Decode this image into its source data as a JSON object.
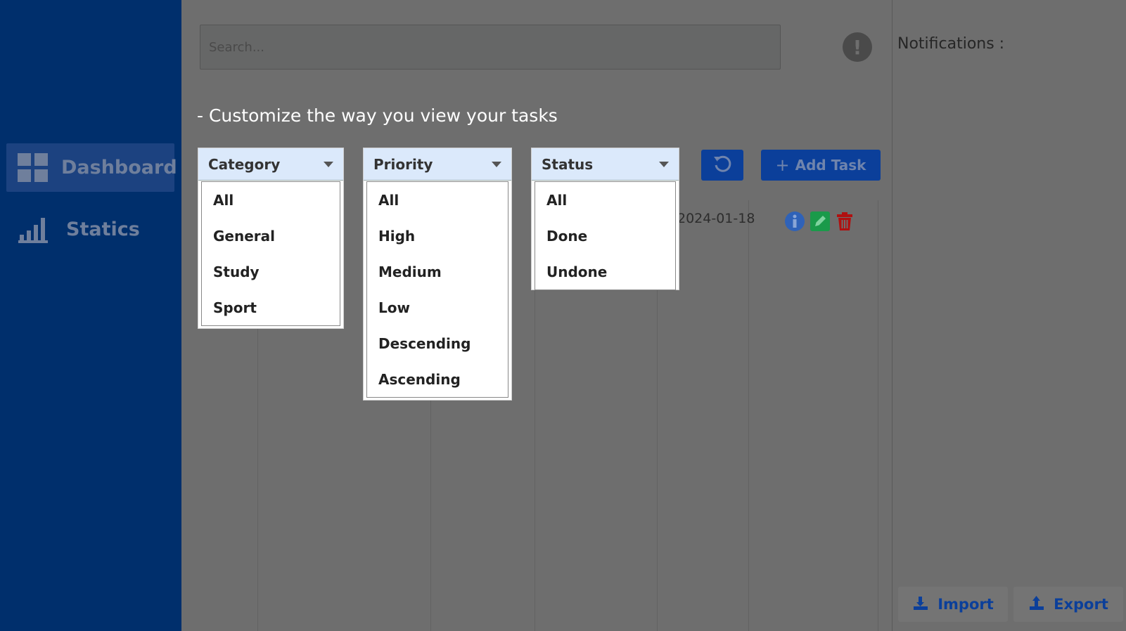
{
  "sidebar": {
    "items": [
      {
        "label": "Dashboard",
        "icon": "dashboard-grid-icon",
        "active": true
      },
      {
        "label": "Statics",
        "icon": "bar-chart-icon",
        "active": false
      }
    ]
  },
  "search": {
    "placeholder": "Search..."
  },
  "main": {
    "heading": "- Customize the way you view your tasks",
    "filters": {
      "category": {
        "label": "Category",
        "options": [
          "All",
          "General",
          "Study",
          "Sport"
        ]
      },
      "priority": {
        "label": "Priority",
        "options": [
          "All",
          "High",
          "Medium",
          "Low",
          "Descending",
          "Ascending"
        ]
      },
      "status": {
        "label": "Status",
        "options": [
          "All",
          "Done",
          "Undone"
        ]
      }
    },
    "add_task_label": "Add Task",
    "task_row": {
      "date": "2024-01-18"
    }
  },
  "notifications": {
    "title": "Notifications :"
  },
  "footer": {
    "import_label": "Import",
    "export_label": "Export"
  },
  "colors": {
    "sidebar": "#002f6c",
    "accent": "#0b3f9a",
    "edit": "#1a9a4a",
    "delete": "#b01010",
    "info": "#2f62b8"
  }
}
